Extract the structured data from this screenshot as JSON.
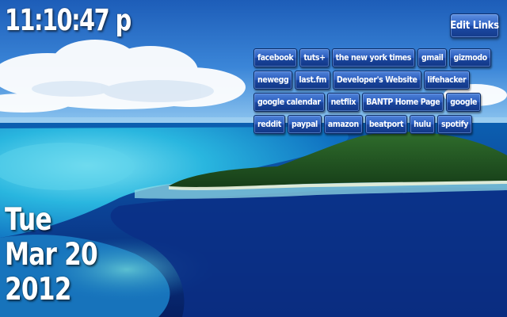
{
  "clock": {
    "time": "11:10:47 p"
  },
  "date": {
    "weekday": "Tue",
    "month_day": "Mar 20",
    "year": "2012"
  },
  "edit_links_label": "Edit Links",
  "links": [
    "facebook",
    "tuts+",
    "the new york times",
    "gmail",
    "gizmodo",
    "newegg",
    "last.fm",
    "Developer's Website",
    "lifehacker",
    "google calendar",
    "netflix",
    "BANTP Home Page",
    "google",
    "reddit",
    "paypal",
    "amazon",
    "beatport",
    "hulu",
    "spotify"
  ],
  "colors": {
    "button_top": "#4f82d8",
    "button_bottom": "#123785",
    "text": "#ffffff"
  }
}
